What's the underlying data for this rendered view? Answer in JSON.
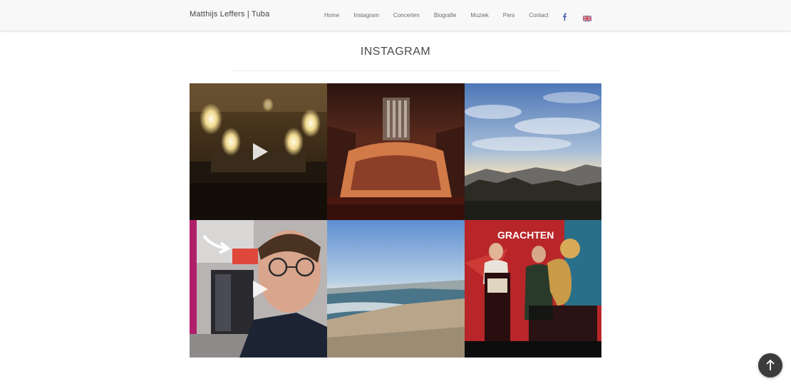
{
  "header": {
    "brand": "Matthijs Leffers | Tuba",
    "nav": [
      {
        "label": "Home"
      },
      {
        "label": "Instagram"
      },
      {
        "label": "Concerten"
      },
      {
        "label": "Biografie"
      },
      {
        "label": "Muziek"
      },
      {
        "label": "Pers"
      },
      {
        "label": "Contact"
      }
    ],
    "social_icon": "facebook-icon",
    "language_icon": "uk-flag-icon",
    "accent_color": "#4a67ad"
  },
  "main": {
    "title": "INSTAGRAM",
    "posts": [
      {
        "subject": "concert hall with chandeliers",
        "type": "video",
        "icon": "play-icon"
      },
      {
        "subject": "orchestra on stage in concert hall",
        "type": "image"
      },
      {
        "subject": "landscape with cloudy sky",
        "type": "image"
      },
      {
        "subject": "selfie with arrow pointing at screen",
        "type": "video",
        "icon": "play-icon"
      },
      {
        "subject": "beach and sea",
        "type": "image"
      },
      {
        "subject": "tuba player performing on stage",
        "type": "image",
        "overlay_text": "GRACHTEN"
      }
    ]
  },
  "back_to_top": {
    "icon": "arrow-up-icon",
    "color": "#3b3b3b"
  }
}
